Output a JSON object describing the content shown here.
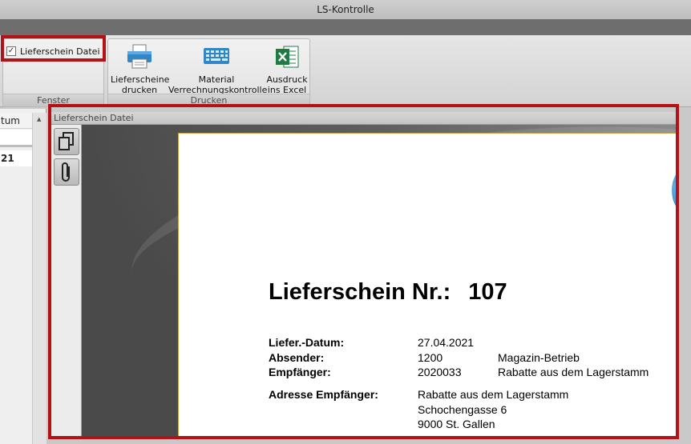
{
  "window": {
    "title": "LS-Kontrolle"
  },
  "ribbon": {
    "fenster": {
      "label": "Fenster",
      "checkbox_label": "Lieferschein Datei",
      "checkbox_checked": true,
      "check_mark": "✓"
    },
    "drucken": {
      "label": "Drucken",
      "buttons": [
        {
          "line1": "Lieferscheine",
          "line2": "drucken",
          "icon": "printer-icon"
        },
        {
          "line1": "Material",
          "line2": "Verrechnungskontrolle",
          "icon": "keyboard-calculator-icon"
        },
        {
          "line1": "Ausdruck",
          "line2": "ins Excel",
          "icon": "excel-icon"
        }
      ]
    }
  },
  "left_list": {
    "header": "tum",
    "row_value": "21"
  },
  "document_panel": {
    "title": "Lieferschein Datei",
    "toolbar": [
      {
        "icon": "copy-pages-icon"
      },
      {
        "icon": "paperclip-icon"
      }
    ]
  },
  "document": {
    "title": "Lieferschein Nr.:",
    "number": "107",
    "fields": [
      {
        "label": "Liefer.-Datum:",
        "value": "27.04.2021",
        "extra": ""
      },
      {
        "label": "Absender:",
        "value": "1200",
        "extra": "Magazin-Betrieb"
      },
      {
        "label": "Empfänger:",
        "value": "2020033",
        "extra": "Rabatte aus dem Lagerstamm"
      }
    ],
    "address_label": "Adresse Empfänger:",
    "address_lines": [
      "Rabatte aus dem Lagerstamm",
      "Schochengasse 6",
      "9000 St. Gallen"
    ]
  },
  "colors": {
    "highlight": "#b31217",
    "excel_green": "#1f7a45",
    "printer_blue": "#2f86c9"
  }
}
